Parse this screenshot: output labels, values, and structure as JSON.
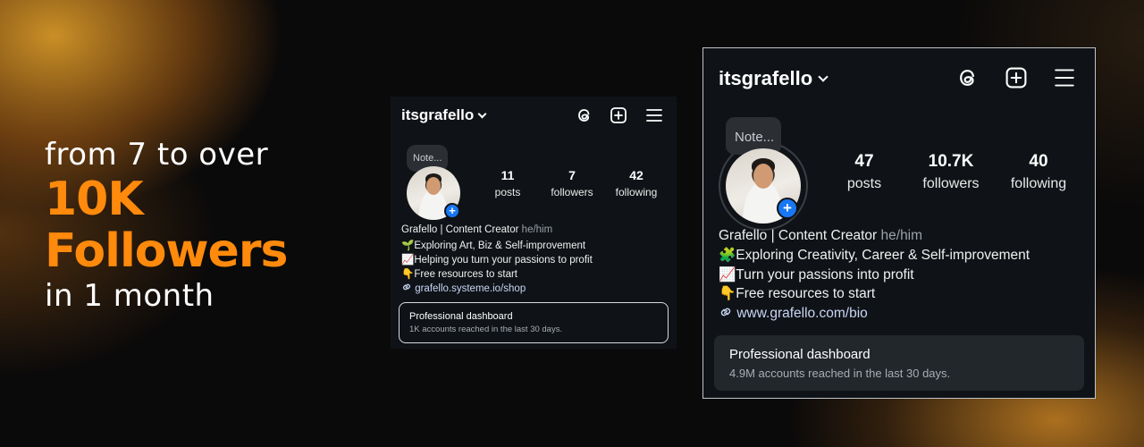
{
  "headline": {
    "line1": "from 7 to over",
    "line2": "10K",
    "line3": "Followers",
    "line4": "in 1 month",
    "accent_color": "#ff8a0c"
  },
  "before": {
    "username": "itsgrafello",
    "note": "Note...",
    "stats": [
      {
        "value": "11",
        "label": "posts"
      },
      {
        "value": "7",
        "label": "followers"
      },
      {
        "value": "42",
        "label": "following"
      }
    ],
    "name": "Grafello | Content Creator",
    "pronouns": "he/him",
    "bio": [
      "🌱Exploring Art, Biz & Self-improvement",
      "📈Helping you turn your passions to profit",
      "👇Free resources to start"
    ],
    "link": "grafello.systeme.io/shop",
    "dashboard_title": "Professional dashboard",
    "dashboard_sub": "1K accounts reached in the last 30 days."
  },
  "after": {
    "username": "itsgrafello",
    "note": "Note...",
    "stats": [
      {
        "value": "47",
        "label": "posts"
      },
      {
        "value": "10.7K",
        "label": "followers"
      },
      {
        "value": "40",
        "label": "following"
      }
    ],
    "name": "Grafello | Content Creator",
    "pronouns": "he/him",
    "bio": [
      "🧩Exploring Creativity, Career & Self-improvement",
      "📈Turn your passions into profit",
      "👇Free resources to start"
    ],
    "link": "www.grafello.com/bio",
    "dashboard_title": "Professional dashboard",
    "dashboard_sub": "4.9M accounts reached in the last 30 days."
  },
  "icons": [
    "threads-icon",
    "new-post-icon",
    "menu-icon",
    "chevron-down-icon",
    "link-icon",
    "add-story-icon"
  ]
}
